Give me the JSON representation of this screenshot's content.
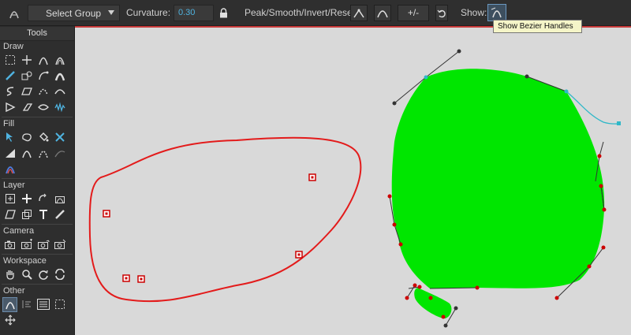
{
  "toolbar": {
    "select_group": "Select Group",
    "curvature_label": "Curvature:",
    "curvature_value": "0.30",
    "modes_label": "Peak/Smooth/Invert/Reset:",
    "plus_minus": "+/-",
    "show_label": "Show:"
  },
  "tooltip": {
    "text": "Show Bezier Handles"
  },
  "tools": {
    "title": "Tools",
    "sections": {
      "draw": "Draw",
      "fill": "Fill",
      "layer": "Layer",
      "camera": "Camera",
      "workspace": "Workspace",
      "other": "Other"
    }
  },
  "colors": {
    "accent_red": "#e31b1b",
    "fill_green": "#00e600",
    "handle_cyan": "#2fb8c8",
    "canvas_bg": "#d9d9d9"
  }
}
